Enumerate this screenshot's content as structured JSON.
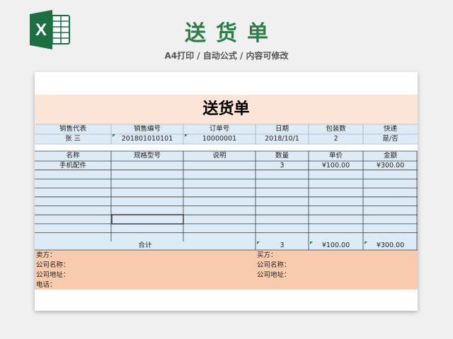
{
  "header": {
    "title": "送货单",
    "subtitle": "A4打印 / 自动公式 / 内容可修改",
    "logo_letter": "X",
    "logo_icon": "excel-icon",
    "accent_color": "#2e7d4a"
  },
  "sheet": {
    "title": "送货单",
    "info_headers": [
      "销售代表",
      "销售编号",
      "订单号",
      "日期",
      "包装数",
      "快递"
    ],
    "info_values": [
      "张 三",
      "201801010101",
      "10000001",
      "2018/10/1",
      "2",
      "是/否"
    ],
    "item_headers": [
      "名称",
      "规格型号",
      "说明",
      "数量",
      "单价",
      "金额"
    ],
    "items": [
      {
        "name": "手机配件",
        "spec": "",
        "desc": "",
        "qty": "3",
        "price": "¥100.00",
        "amount": "¥300.00"
      }
    ],
    "total_label": "合计",
    "total_qty": "3",
    "total_price": "¥100.00",
    "total_amount": "¥300.00",
    "seller_labels": [
      "卖方：",
      "公司名称：",
      "公司地址：",
      "电话："
    ],
    "buyer_labels": [
      "买方：",
      "公司名称：",
      "公司地址："
    ],
    "colors": {
      "title_band": "#fce4d6",
      "info_band": "#ddebf7",
      "table_band": "#ddebf7",
      "footer_band": "#f8cbad"
    }
  }
}
